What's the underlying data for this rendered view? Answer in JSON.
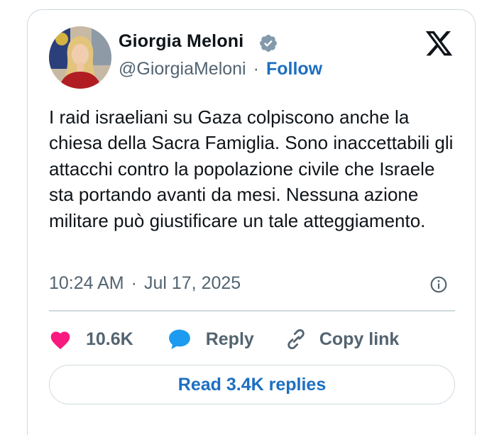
{
  "author": {
    "name": "Giorgia Meloni",
    "handle": "@GiorgiaMeloni",
    "separator": "·",
    "follow_label": "Follow"
  },
  "tweet": {
    "text": "I raid israeliani su Gaza colpiscono anche la chiesa della Sacra Famiglia. Sono inaccettabili gli attacchi contro la popolazione civile che Israele sta portando avanti da mesi. Nessuna azione militare può giustificare un tale atteggiamento.",
    "time": "10:24 AM",
    "separator": "·",
    "date": "Jul 17, 2025"
  },
  "actions": {
    "like_count": "10.6K",
    "reply_label": "Reply",
    "copy_link_label": "Copy link"
  },
  "footer": {
    "read_replies_label": "Read 3.4K replies"
  },
  "colors": {
    "like": "#f91880",
    "reply": "#1d9bf0",
    "link": "#1d6fc2",
    "muted": "#536471",
    "border": "#cfd9de"
  },
  "icons": [
    "verified-badge-icon",
    "x-logo-icon",
    "info-icon",
    "heart-icon",
    "reply-bubble-icon",
    "link-icon"
  ]
}
